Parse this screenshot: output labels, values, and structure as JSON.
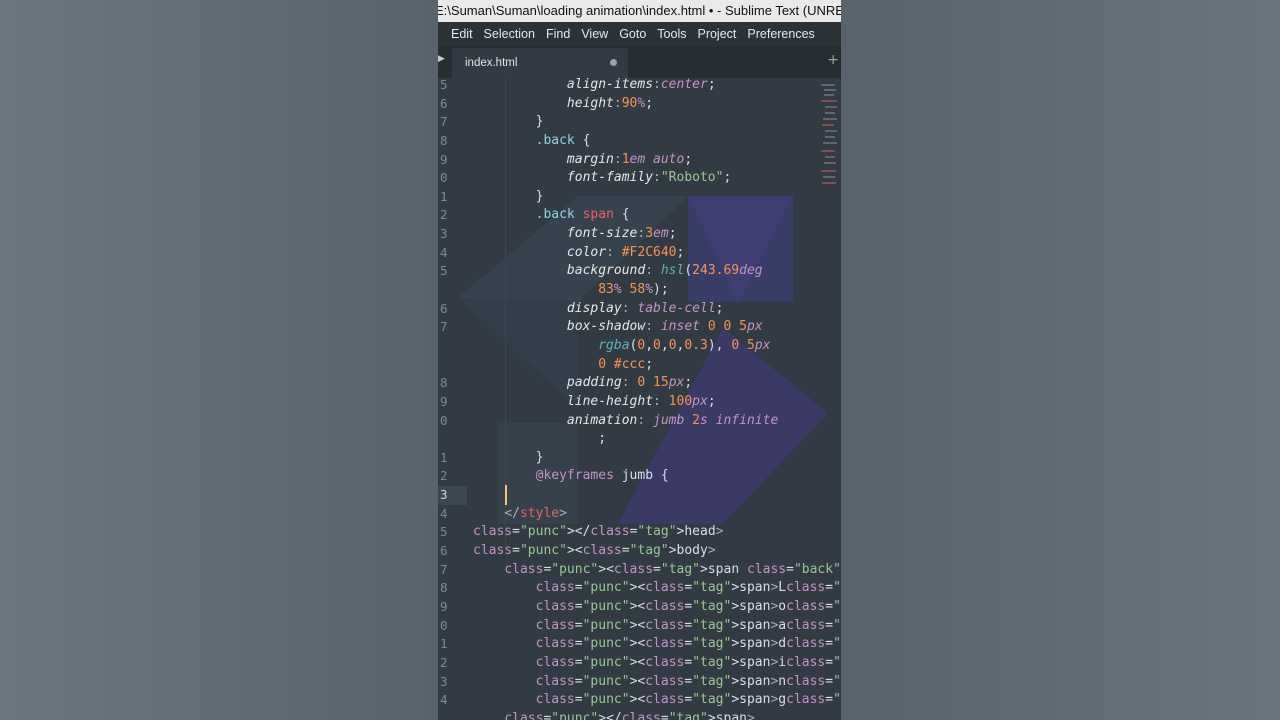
{
  "window": {
    "title": "E:\\Suman\\Suman\\loading animation\\index.html • - Sublime Text (UNREGISTERED)"
  },
  "menu": [
    "Edit",
    "Selection",
    "Find",
    "View",
    "Goto",
    "Tools",
    "Project",
    "Preferences"
  ],
  "tab": {
    "label": "index.html",
    "modified": true
  },
  "icons": {
    "sidebar_toggle": "triangle-right-icon",
    "tab_dirty": "dot-icon",
    "new_tab": "plus-icon"
  },
  "colors": {
    "editor_bg": "#323b43",
    "selector": "#8fd3e3",
    "tag": "#ec5f67",
    "number": "#f99157",
    "string": "#99c794",
    "value": "#c594c5",
    "cursor": "#f0c674"
  },
  "editor": {
    "current_line": 3,
    "lines": [
      {
        "n": "5",
        "t": "            align-items:center;"
      },
      {
        "n": "6",
        "t": "            height:90%;"
      },
      {
        "n": "7",
        "t": "        }"
      },
      {
        "n": "8",
        "t": "        .back {"
      },
      {
        "n": "9",
        "t": "            margin:1em auto;"
      },
      {
        "n": "0",
        "t": "            font-family:\"Roboto\";"
      },
      {
        "n": "1",
        "t": "        }"
      },
      {
        "n": "2",
        "t": "        .back span {"
      },
      {
        "n": "3",
        "t": "            font-size:3em;"
      },
      {
        "n": "4",
        "t": "            color: #F2C640;"
      },
      {
        "n": "5",
        "t": "            background: hsl(243.69deg"
      },
      {
        "n": "",
        "t": "                83% 58%);"
      },
      {
        "n": "6",
        "t": "            display: table-cell;"
      },
      {
        "n": "7",
        "t": "            box-shadow: inset 0 0 5px"
      },
      {
        "n": "",
        "t": "                rgba(0,0,0,0.3), 0 5px"
      },
      {
        "n": "",
        "t": "                0 #ccc;"
      },
      {
        "n": "8",
        "t": "            padding: 0 15px;"
      },
      {
        "n": "9",
        "t": "            line-height: 100px;"
      },
      {
        "n": "0",
        "t": "            animation: jumb 2s infinite"
      },
      {
        "n": "",
        "t": "                ;"
      },
      {
        "n": "1",
        "t": "        }"
      },
      {
        "n": "2",
        "t": "        @keyframes jumb {"
      },
      {
        "n": "3",
        "t": ""
      },
      {
        "n": "4",
        "t": "    </style>"
      },
      {
        "n": "5",
        "t": "</head>"
      },
      {
        "n": "6",
        "t": "<body>"
      },
      {
        "n": "7",
        "t": "    <span class=\"back\">"
      },
      {
        "n": "8",
        "t": "        <span>L</span>"
      },
      {
        "n": "9",
        "t": "        <span>o</span>"
      },
      {
        "n": "0",
        "t": "        <span>a</span>"
      },
      {
        "n": "1",
        "t": "        <span>d</span>"
      },
      {
        "n": "2",
        "t": "        <span>i</span>"
      },
      {
        "n": "3",
        "t": "        <span>n</span>"
      },
      {
        "n": "4",
        "t": "        <span>g</span>"
      },
      {
        "n": "",
        "t": "    </span>"
      }
    ]
  }
}
